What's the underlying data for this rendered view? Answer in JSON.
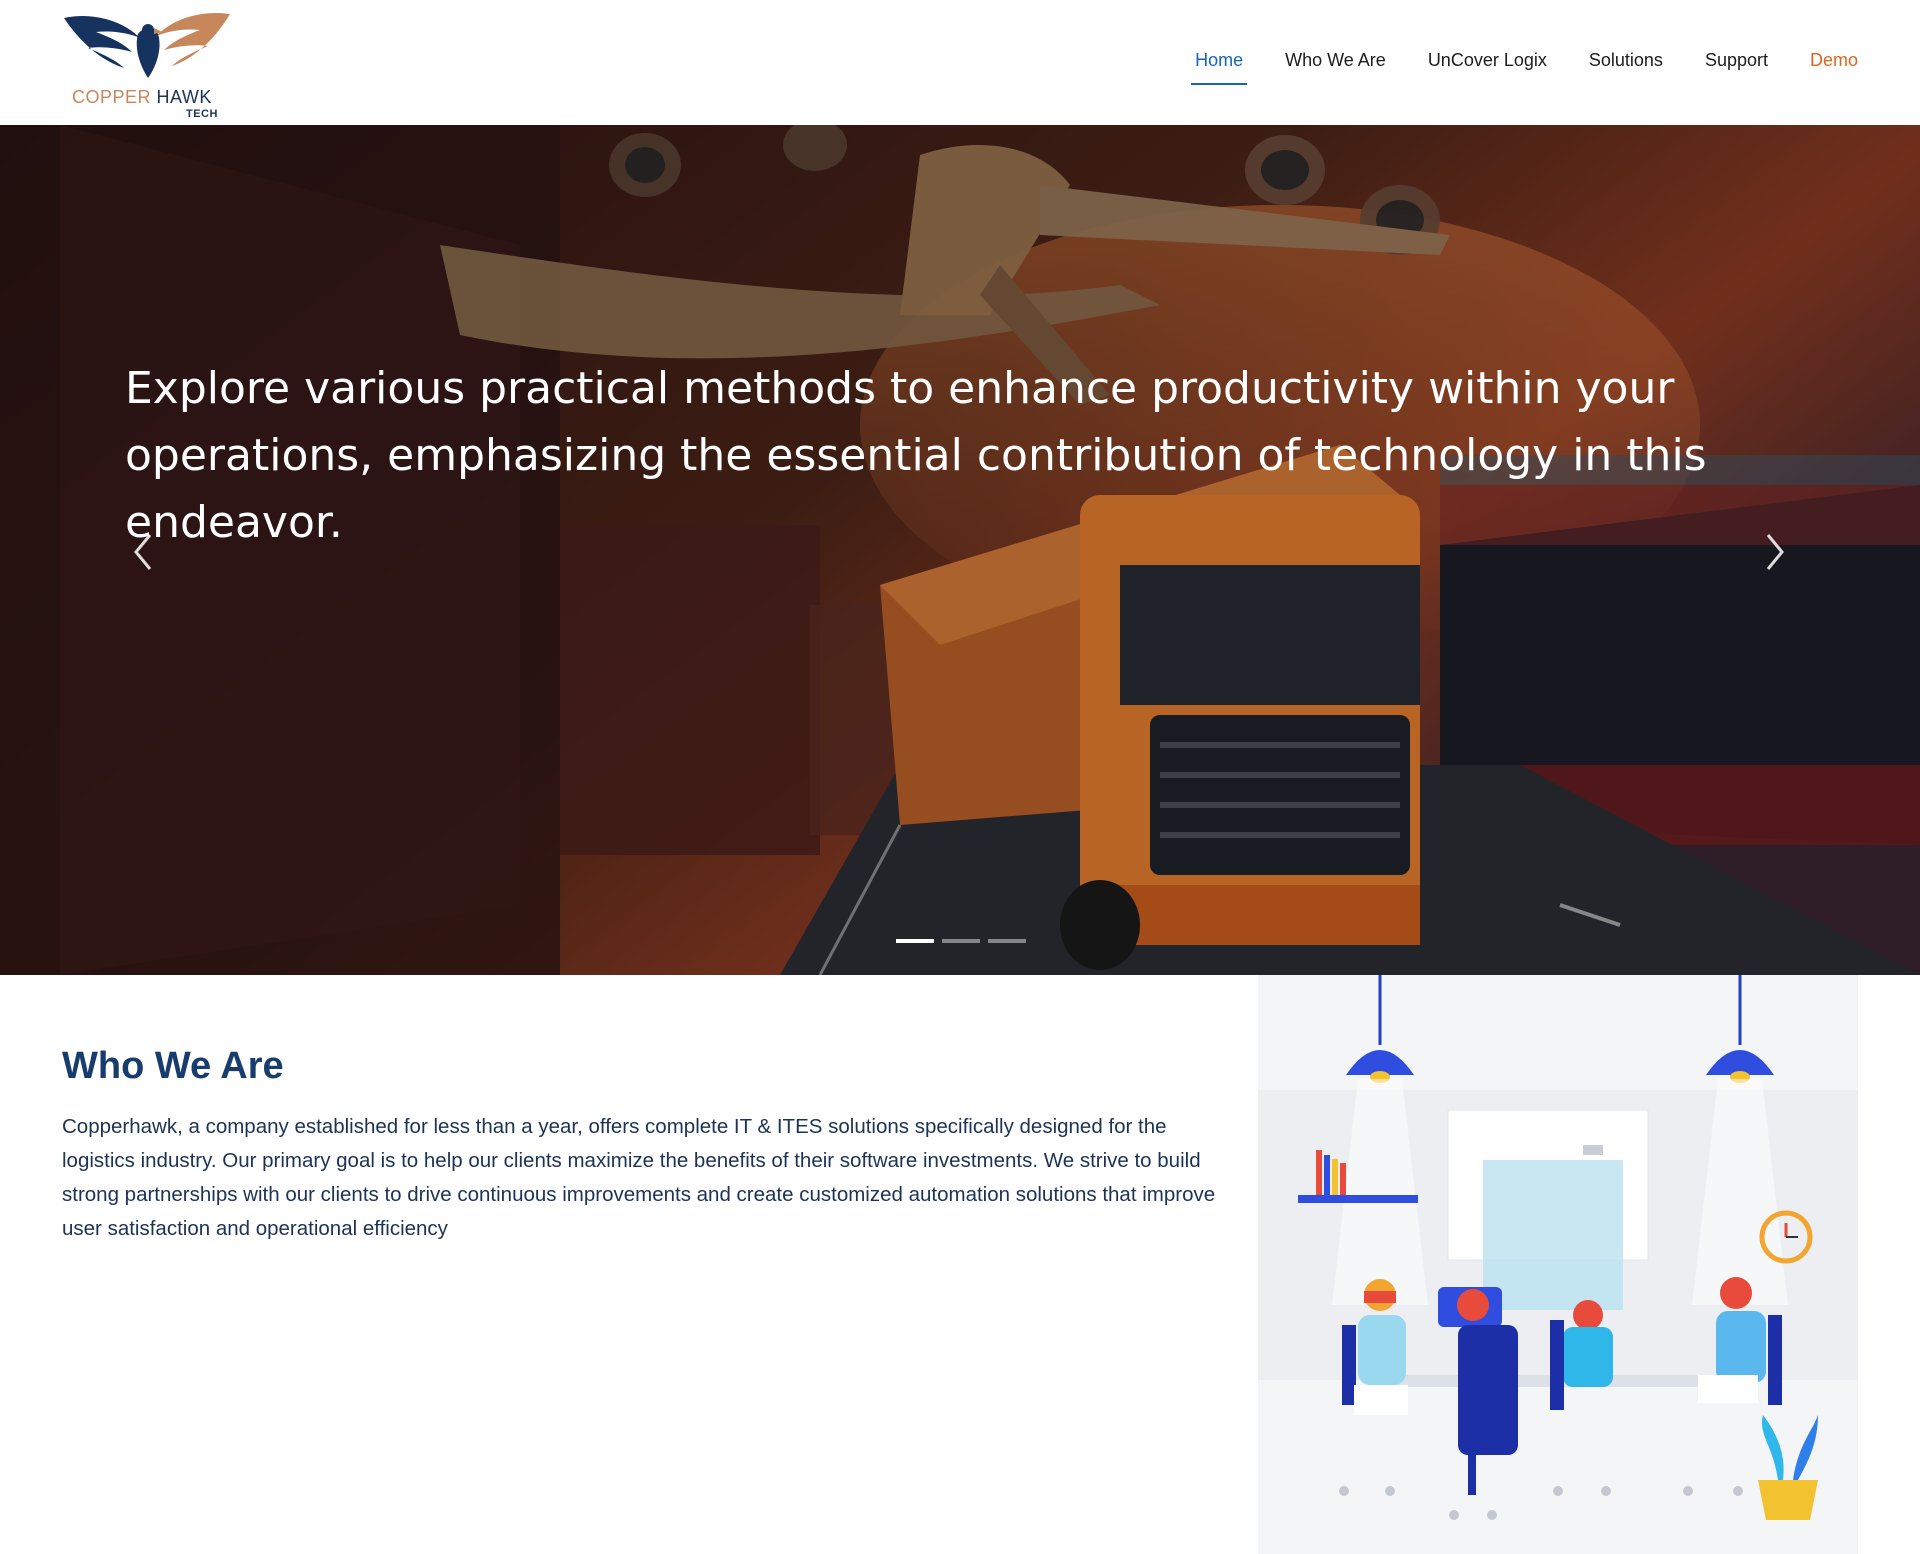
{
  "header": {
    "logo_word1": "COPPER",
    "logo_word2": "HAWK",
    "logo_sub": "TECH"
  },
  "nav": {
    "items": [
      {
        "label": "Home",
        "active": true
      },
      {
        "label": "Who We Are"
      },
      {
        "label": "UnCover Logix"
      },
      {
        "label": "Solutions"
      },
      {
        "label": "Support"
      },
      {
        "label": "Demo"
      }
    ]
  },
  "hero": {
    "headline": "Explore various practical methods to enhance productivity within your operations, emphasizing the essential contribution of technology in this endeavor.",
    "slide_count": 3,
    "active_slide": 1
  },
  "who": {
    "title": "Who We Are",
    "text": "Copperhawk, a company established for less than a year, offers complete IT & ITES solutions specifically designed for the logistics industry. Our primary goal is to help our clients maximize the benefits of their software investments. We strive to build strong partnerships with our clients to drive continuous improvements and create customized automation solutions that improve user satisfaction and operational efficiency"
  },
  "colors": {
    "accent": "#1565c0",
    "demo": "#e0651f",
    "heading": "#173c6e"
  }
}
